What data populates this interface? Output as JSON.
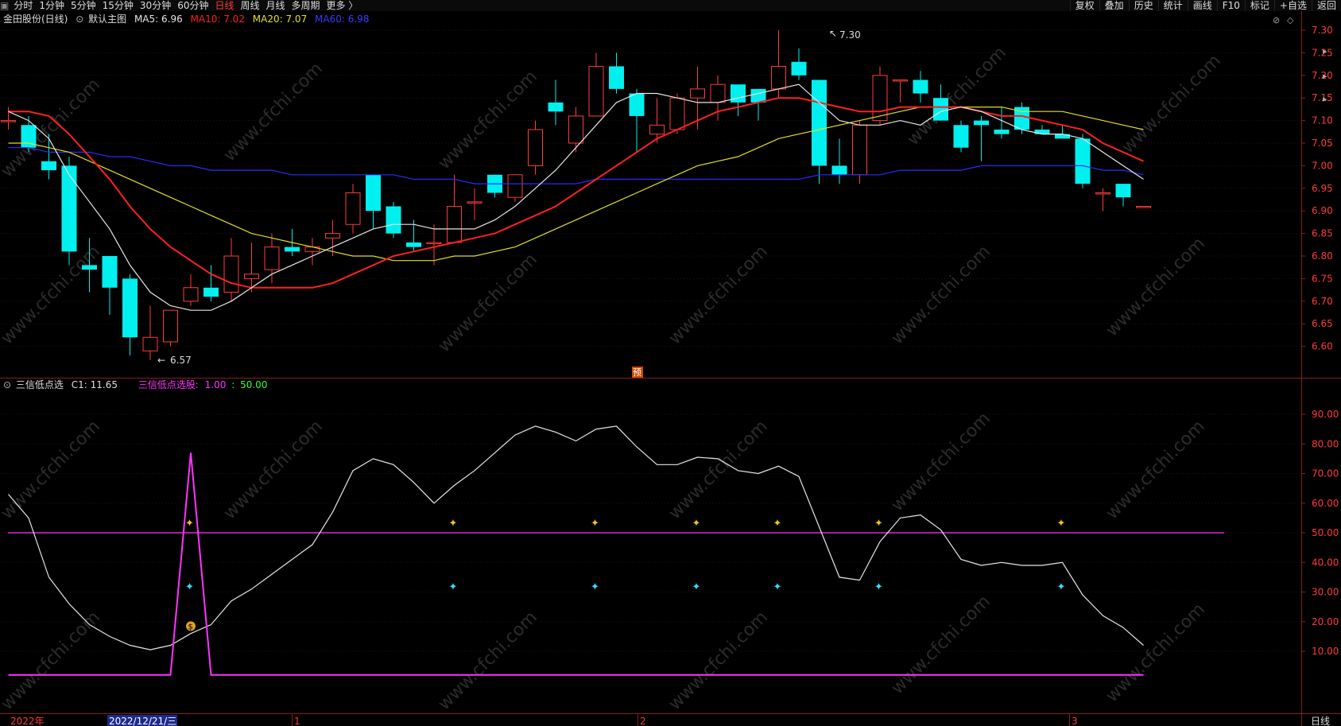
{
  "top_menu": {
    "left": [
      "分时",
      "1分钟",
      "5分钟",
      "15分钟",
      "30分钟",
      "60分钟",
      "日线",
      "周线",
      "月线",
      "多周期",
      "更多 〉"
    ],
    "active": "日线",
    "right": [
      "复权",
      "叠加",
      "历史",
      "统计",
      "画线",
      "F10",
      "标记",
      "+自选",
      "返回"
    ]
  },
  "main_info": {
    "stock": "金田股份(日线)",
    "template": "默认主图",
    "ma5": "MA5: 6.96",
    "ma10": "MA10: 7.02",
    "ma20": "MA20: 7.07",
    "ma60": "MA60: 6.98"
  },
  "colors": {
    "up": "#ff3b3b",
    "down": "#00f0f0",
    "ma5": "#e6e6e6",
    "ma10": "#ff2020",
    "ma20": "#e0e020",
    "ma60": "#2b2bff",
    "indicator": "#ff33ff"
  },
  "price_axis": [
    "7.30",
    "7.25",
    "7.20",
    "7.15",
    "7.10",
    "7.05",
    "7.00",
    "6.95",
    "6.90",
    "6.85",
    "6.80",
    "6.75",
    "6.70",
    "6.65",
    "6.60"
  ],
  "price_marks": {
    "high": "7.30",
    "low": "6.57"
  },
  "main_badge": "预",
  "chart_data": [
    {
      "type": "candlestick",
      "ylim": [
        6.55,
        7.32
      ],
      "candles": [
        {
          "o": 7.1,
          "h": 7.13,
          "l": 7.08,
          "c": 7.1
        },
        {
          "o": 7.09,
          "h": 7.11,
          "l": 7.03,
          "c": 7.04
        },
        {
          "o": 7.01,
          "h": 7.07,
          "l": 6.97,
          "c": 6.99
        },
        {
          "o": 7.0,
          "h": 7.02,
          "l": 6.78,
          "c": 6.81
        },
        {
          "o": 6.78,
          "h": 6.84,
          "l": 6.72,
          "c": 6.77
        },
        {
          "o": 6.8,
          "h": 6.8,
          "l": 6.67,
          "c": 6.73
        },
        {
          "o": 6.75,
          "h": 6.76,
          "l": 6.58,
          "c": 6.62
        },
        {
          "o": 6.59,
          "h": 6.69,
          "l": 6.57,
          "c": 6.62
        },
        {
          "o": 6.61,
          "h": 6.68,
          "l": 6.6,
          "c": 6.68
        },
        {
          "o": 6.7,
          "h": 6.76,
          "l": 6.69,
          "c": 6.73
        },
        {
          "o": 6.73,
          "h": 6.78,
          "l": 6.7,
          "c": 6.71
        },
        {
          "o": 6.72,
          "h": 6.84,
          "l": 6.7,
          "c": 6.8
        },
        {
          "o": 6.75,
          "h": 6.83,
          "l": 6.72,
          "c": 6.76
        },
        {
          "o": 6.77,
          "h": 6.85,
          "l": 6.74,
          "c": 6.82
        },
        {
          "o": 6.82,
          "h": 6.86,
          "l": 6.8,
          "c": 6.81
        },
        {
          "o": 6.81,
          "h": 6.84,
          "l": 6.78,
          "c": 6.82
        },
        {
          "o": 6.84,
          "h": 6.88,
          "l": 6.8,
          "c": 6.85
        },
        {
          "o": 6.87,
          "h": 6.96,
          "l": 6.85,
          "c": 6.94
        },
        {
          "o": 6.98,
          "h": 6.98,
          "l": 6.86,
          "c": 6.9
        },
        {
          "o": 6.91,
          "h": 6.92,
          "l": 6.84,
          "c": 6.85
        },
        {
          "o": 6.83,
          "h": 6.88,
          "l": 6.81,
          "c": 6.82
        },
        {
          "o": 6.83,
          "h": 6.87,
          "l": 6.78,
          "c": 6.83
        },
        {
          "o": 6.83,
          "h": 6.98,
          "l": 6.83,
          "c": 6.91
        },
        {
          "o": 6.92,
          "h": 6.95,
          "l": 6.88,
          "c": 6.92
        },
        {
          "o": 6.98,
          "h": 6.98,
          "l": 6.93,
          "c": 6.94
        },
        {
          "o": 6.93,
          "h": 6.98,
          "l": 6.92,
          "c": 6.98
        },
        {
          "o": 7.0,
          "h": 7.1,
          "l": 6.98,
          "c": 7.08
        },
        {
          "o": 7.14,
          "h": 7.19,
          "l": 7.09,
          "c": 7.12
        },
        {
          "o": 7.05,
          "h": 7.13,
          "l": 7.03,
          "c": 7.11
        },
        {
          "o": 7.11,
          "h": 7.25,
          "l": 7.11,
          "c": 7.22
        },
        {
          "o": 7.22,
          "h": 7.25,
          "l": 7.16,
          "c": 7.17
        },
        {
          "o": 7.16,
          "h": 7.17,
          "l": 7.03,
          "c": 7.11
        },
        {
          "o": 7.07,
          "h": 7.15,
          "l": 7.05,
          "c": 7.09
        },
        {
          "o": 7.08,
          "h": 7.16,
          "l": 7.07,
          "c": 7.15
        },
        {
          "o": 7.15,
          "h": 7.22,
          "l": 7.08,
          "c": 7.17
        },
        {
          "o": 7.14,
          "h": 7.2,
          "l": 7.1,
          "c": 7.18
        },
        {
          "o": 7.18,
          "h": 7.18,
          "l": 7.11,
          "c": 7.14
        },
        {
          "o": 7.17,
          "h": 7.17,
          "l": 7.1,
          "c": 7.14
        },
        {
          "o": 7.17,
          "h": 7.3,
          "l": 7.15,
          "c": 7.22
        },
        {
          "o": 7.23,
          "h": 7.26,
          "l": 7.19,
          "c": 7.2
        },
        {
          "o": 7.19,
          "h": 7.19,
          "l": 6.96,
          "c": 7.0
        },
        {
          "o": 7.0,
          "h": 7.06,
          "l": 6.96,
          "c": 6.98
        },
        {
          "o": 6.98,
          "h": 7.1,
          "l": 6.96,
          "c": 7.09
        },
        {
          "o": 7.1,
          "h": 7.22,
          "l": 7.09,
          "c": 7.2
        },
        {
          "o": 7.19,
          "h": 7.19,
          "l": 7.14,
          "c": 7.19
        },
        {
          "o": 7.19,
          "h": 7.21,
          "l": 7.14,
          "c": 7.16
        },
        {
          "o": 7.15,
          "h": 7.18,
          "l": 7.1,
          "c": 7.1
        },
        {
          "o": 7.09,
          "h": 7.1,
          "l": 7.03,
          "c": 7.04
        },
        {
          "o": 7.1,
          "h": 7.11,
          "l": 7.01,
          "c": 7.09
        },
        {
          "o": 7.08,
          "h": 7.13,
          "l": 7.06,
          "c": 7.07
        },
        {
          "o": 7.13,
          "h": 7.14,
          "l": 7.07,
          "c": 7.08
        },
        {
          "o": 7.08,
          "h": 7.09,
          "l": 7.07,
          "c": 7.07
        },
        {
          "o": 7.07,
          "h": 7.09,
          "l": 7.06,
          "c": 7.06
        },
        {
          "o": 7.06,
          "h": 7.07,
          "l": 6.95,
          "c": 6.96
        },
        {
          "o": 6.94,
          "h": 6.95,
          "l": 6.9,
          "c": 6.94
        },
        {
          "o": 6.96,
          "h": 6.96,
          "l": 6.91,
          "c": 6.93
        },
        {
          "o": 6.91,
          "h": 6.91,
          "l": 6.91,
          "c": 6.91
        }
      ],
      "ma5": [
        7.12,
        7.1,
        7.06,
        6.98,
        6.92,
        6.86,
        6.78,
        6.72,
        6.69,
        6.68,
        6.68,
        6.7,
        6.73,
        6.76,
        6.78,
        6.8,
        6.82,
        6.84,
        6.86,
        6.87,
        6.87,
        6.86,
        6.86,
        6.86,
        6.88,
        6.91,
        6.95,
        6.99,
        7.04,
        7.09,
        7.14,
        7.16,
        7.16,
        7.15,
        7.14,
        7.14,
        7.15,
        7.16,
        7.17,
        7.18,
        7.14,
        7.1,
        7.09,
        7.09,
        7.1,
        7.09,
        7.12,
        7.13,
        7.12,
        7.1,
        7.08,
        7.07,
        7.07,
        7.06,
        7.03,
        7.0,
        6.97
      ],
      "ma10": [
        7.12,
        7.12,
        7.11,
        7.07,
        7.02,
        6.97,
        6.91,
        6.86,
        6.82,
        6.79,
        6.76,
        6.74,
        6.73,
        6.73,
        6.73,
        6.73,
        6.74,
        6.76,
        6.78,
        6.8,
        6.81,
        6.82,
        6.83,
        6.84,
        6.85,
        6.87,
        6.89,
        6.91,
        6.94,
        6.97,
        7.0,
        7.03,
        7.06,
        7.08,
        7.1,
        7.12,
        7.13,
        7.14,
        7.15,
        7.15,
        7.14,
        7.13,
        7.12,
        7.12,
        7.13,
        7.13,
        7.13,
        7.13,
        7.12,
        7.11,
        7.11,
        7.1,
        7.09,
        7.08,
        7.05,
        7.03,
        7.01
      ],
      "ma20": [
        7.05,
        7.05,
        7.04,
        7.03,
        7.01,
        6.99,
        6.97,
        6.95,
        6.93,
        6.91,
        6.89,
        6.87,
        6.85,
        6.84,
        6.83,
        6.82,
        6.81,
        6.8,
        6.8,
        6.79,
        6.79,
        6.79,
        6.8,
        6.8,
        6.81,
        6.82,
        6.84,
        6.86,
        6.88,
        6.9,
        6.92,
        6.94,
        6.96,
        6.98,
        7.0,
        7.01,
        7.02,
        7.04,
        7.06,
        7.07,
        7.08,
        7.09,
        7.1,
        7.11,
        7.12,
        7.13,
        7.13,
        7.13,
        7.13,
        7.13,
        7.12,
        7.12,
        7.12,
        7.11,
        7.1,
        7.09,
        7.08
      ],
      "ma60": [
        7.04,
        7.04,
        7.03,
        7.03,
        7.03,
        7.02,
        7.02,
        7.01,
        7.0,
        7.0,
        6.99,
        6.99,
        6.99,
        6.99,
        6.98,
        6.98,
        6.98,
        6.98,
        6.98,
        6.98,
        6.97,
        6.97,
        6.97,
        6.96,
        6.96,
        6.96,
        6.96,
        6.96,
        6.96,
        6.97,
        6.97,
        6.97,
        6.97,
        6.97,
        6.97,
        6.97,
        6.97,
        6.97,
        6.97,
        6.97,
        6.98,
        6.98,
        6.98,
        6.98,
        6.99,
        6.99,
        6.99,
        6.99,
        7.0,
        7.0,
        7.0,
        7.0,
        7.0,
        7.0,
        6.99,
        6.99,
        6.98
      ]
    },
    {
      "type": "line",
      "ylim": [
        0,
        100
      ],
      "title": "三信低点选",
      "series": [
        {
          "name": "C1",
          "values": [
            63,
            55,
            35,
            26,
            19,
            15,
            12,
            10.5,
            12,
            16,
            19,
            27,
            31,
            36,
            41,
            46,
            57,
            71,
            75,
            73,
            67,
            60,
            66,
            71,
            77,
            83,
            86,
            84,
            81,
            85,
            86,
            79,
            73,
            73,
            75.5,
            75,
            71,
            70,
            72.5,
            69,
            52,
            35,
            34,
            47,
            55,
            56,
            51,
            41,
            39,
            40,
            39,
            39,
            40,
            29,
            22,
            18,
            12
          ]
        },
        {
          "name": "三信低点选股",
          "values": [
            2,
            2,
            2,
            2,
            2,
            2,
            2,
            2,
            2,
            77,
            2,
            2,
            2,
            2,
            2,
            2,
            2,
            2,
            2,
            2,
            2,
            2,
            2,
            2,
            2,
            2,
            2,
            2,
            2,
            2,
            2,
            2,
            2,
            2,
            2,
            2,
            2,
            2,
            2,
            2,
            2,
            2,
            2,
            2,
            2,
            2,
            2,
            2,
            2,
            2,
            2,
            2,
            2,
            2,
            2,
            2,
            2
          ]
        }
      ],
      "reference_line": 50,
      "markers_top": [
        9,
        22,
        29,
        34,
        38,
        43,
        52
      ],
      "markers_bottom": [
        9,
        22,
        29,
        34,
        38,
        43,
        52
      ],
      "money_marker": 9,
      "axis": [
        "90.00",
        "80.00",
        "70.00",
        "60.00",
        "50.00",
        "40.00",
        "30.00",
        "20.00",
        "10.00"
      ]
    }
  ],
  "indicator_info": {
    "name": "三信低点选",
    "c1": "C1: 11.65",
    "label": "三信低点选股:",
    "v1": "1.00",
    "sep": ":",
    "v2": "50.00"
  },
  "bottom_axis": {
    "year": "2022年",
    "cursor_date": "2022/12/21/三",
    "months": [
      "1",
      "2",
      "3"
    ],
    "period": "日线"
  },
  "watermark": "www.cfchi.com"
}
